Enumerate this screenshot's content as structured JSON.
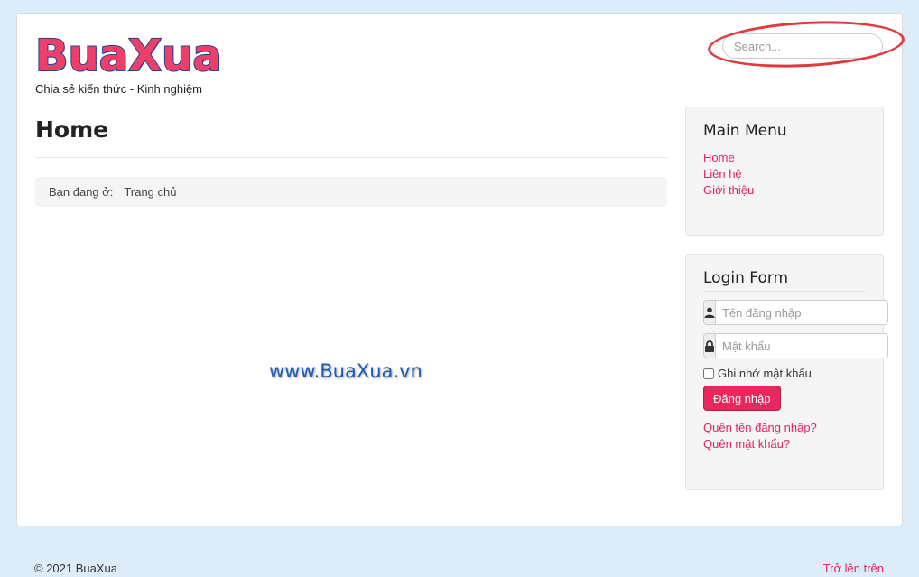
{
  "site": {
    "logo_text": "BuaXua",
    "tagline": "Chia sẻ kiến thức - Kinh nghiệm"
  },
  "search": {
    "placeholder": "Search..."
  },
  "main": {
    "title": "Home",
    "breadcrumb": {
      "label": "Bạn đang ở:",
      "current": "Trang chủ"
    },
    "watermark": "www.BuaXua.vn"
  },
  "main_menu": {
    "title": "Main Menu",
    "items": [
      {
        "label": "Home"
      },
      {
        "label": "Liên hệ"
      },
      {
        "label": "Giới thiệu"
      }
    ]
  },
  "login_form": {
    "title": "Login Form",
    "username_placeholder": "Tên đăng nhập",
    "password_placeholder": "Mật khẩu",
    "remember_label": "Ghi nhớ mật khẩu",
    "login_button": "Đăng nhập",
    "forgot_username": "Quên tên đăng nhập?",
    "forgot_password": "Quên mật khẩu?"
  },
  "footer": {
    "copyright": "© 2021 BuaXua",
    "back_to_top": "Trở lên trên"
  },
  "colors": {
    "accent": "#e0245e",
    "background": "#ddecf9",
    "highlight_circle": "#e0393e"
  }
}
